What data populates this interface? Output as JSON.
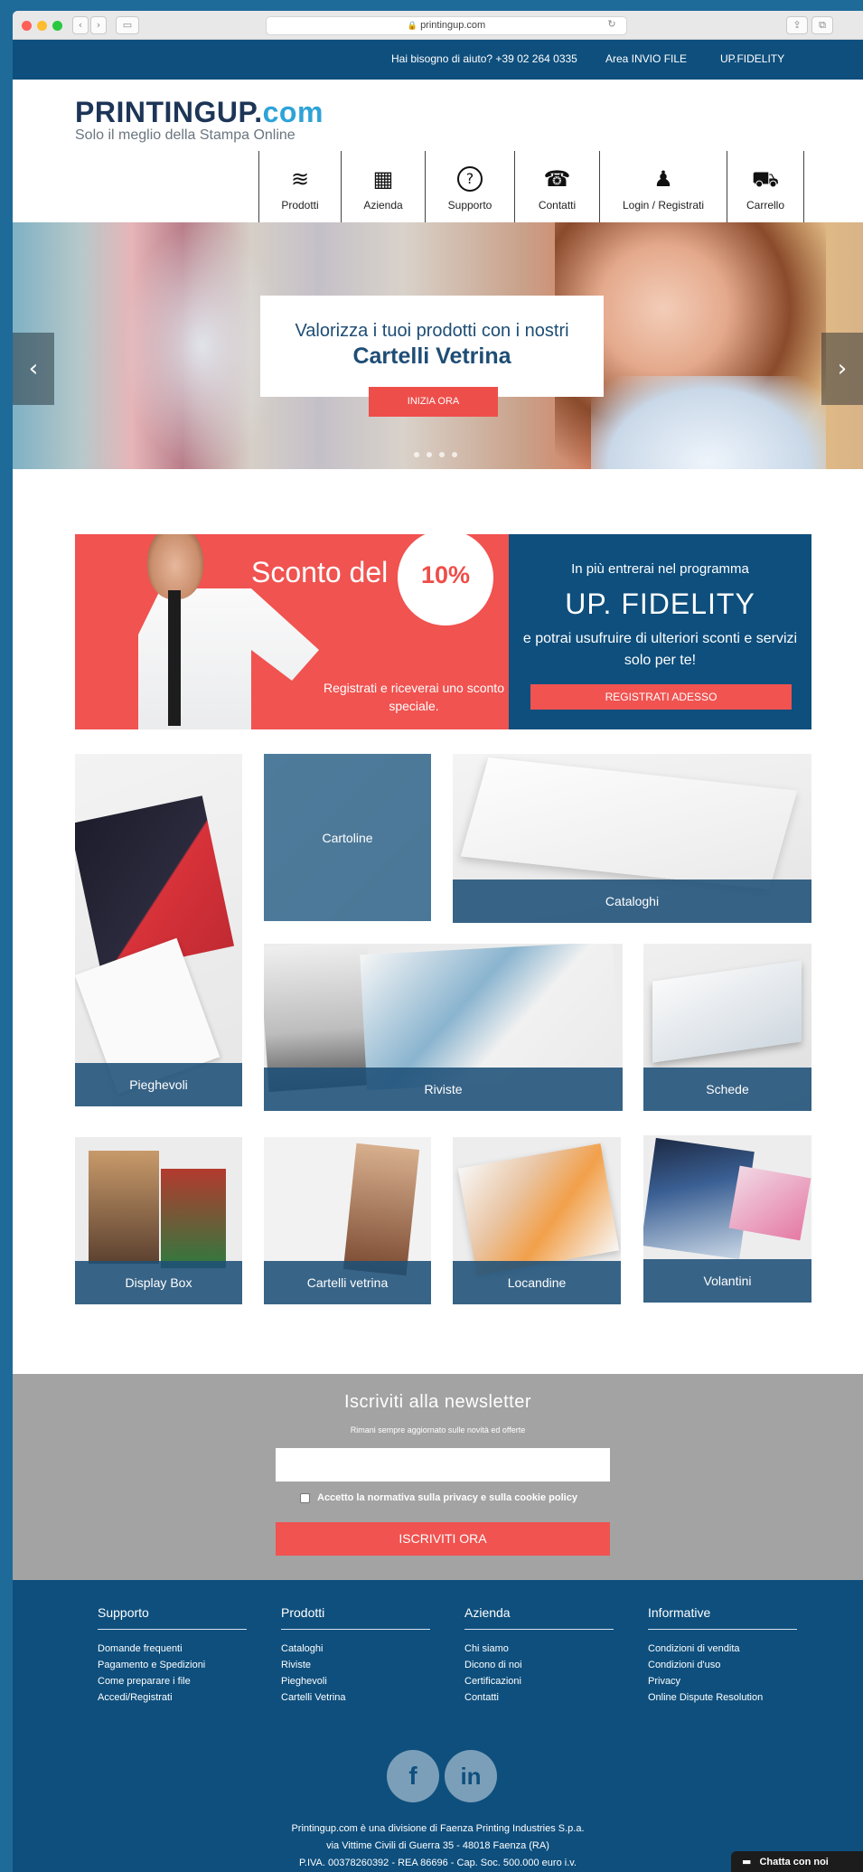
{
  "browser": {
    "url": "printingup.com",
    "lock_icon": "lock-icon",
    "colors": {
      "close": "#fe5f57",
      "minimize": "#febc2e",
      "zoom": "#28c840"
    }
  },
  "topbar": {
    "help_text": "Hai bisogno di aiuto? +39 02 264 0335",
    "upload_link": "Area INVIO FILE",
    "fidelity_link": "UP.FIDELITY"
  },
  "brand": {
    "logo_text": "PRINTINGUP.",
    "logo_suffix": "com",
    "tagline": "Solo il meglio della Stampa Online"
  },
  "nav": {
    "items": [
      {
        "label": "Prodotti",
        "icon": "layers-icon",
        "glyph": "≋"
      },
      {
        "label": "Azienda",
        "icon": "building-icon",
        "glyph": "▦"
      },
      {
        "label": "Supporto",
        "icon": "question-icon",
        "glyph": "?"
      },
      {
        "label": "Contatti",
        "icon": "phone-icon",
        "glyph": "☎"
      },
      {
        "label": "Login / Registrati",
        "icon": "user-icon",
        "glyph": "♟"
      },
      {
        "label": "Carrello",
        "icon": "cart-icon",
        "glyph": "⛟"
      }
    ]
  },
  "hero": {
    "line1": "Valorizza i tuoi prodotti con i nostri",
    "line2": "Cartelli Vetrina",
    "cta": "INIZIA ORA",
    "prev_glyph": "‹",
    "next_glyph": "›",
    "slides_count": 4
  },
  "promo": {
    "headline": "Sconto del",
    "badge": "10%",
    "sub": "Registrati e riceverai uno sconto speciale.",
    "right_line1": "In più entrerai nel programma",
    "right_title": "UP. FIDELITY",
    "right_text": "e potrai usufruire di ulteriori sconti e servizi solo per te!",
    "register_button": "REGISTRATI ADESSO",
    "colors": {
      "red": "#f05350",
      "navy": "#0e4f7d"
    }
  },
  "products": [
    {
      "label": "Pieghevoli"
    },
    {
      "label": "Cartoline"
    },
    {
      "label": "Cataloghi"
    },
    {
      "label": "Riviste"
    },
    {
      "label": "Schede"
    },
    {
      "label": "Display Box"
    },
    {
      "label": "Cartelli vetrina"
    },
    {
      "label": "Locandine"
    },
    {
      "label": "Volantini"
    }
  ],
  "newsletter": {
    "title": "Iscriviti alla newsletter",
    "subtitle": "Rimani sempre aggiornato sulle novità ed offerte",
    "email_value": "",
    "privacy_label": "Accetto la normativa sulla privacy e sulla cookie policy",
    "submit": "ISCRIVITI ORA"
  },
  "footer": {
    "columns": [
      {
        "title": "Supporto",
        "links": [
          "Domande frequenti",
          "Pagamento e Spedizioni",
          "Come preparare i file",
          "Accedi/Registrati"
        ]
      },
      {
        "title": "Prodotti",
        "links": [
          "Cataloghi",
          "Riviste",
          "Pieghevoli",
          "Cartelli Vetrina"
        ]
      },
      {
        "title": "Azienda",
        "links": [
          "Chi siamo",
          "Dicono di noi",
          "Certificazioni",
          "Contatti"
        ]
      },
      {
        "title": "Informative",
        "links": [
          "Condizioni di vendita",
          "Condizioni d'uso",
          "Privacy",
          "Online Dispute Resolution"
        ]
      }
    ],
    "social": [
      {
        "label": "f",
        "icon": "facebook-icon"
      },
      {
        "label": "in",
        "icon": "linkedin-icon"
      }
    ],
    "company_line1": "Printingup.com è una divisione di Faenza Printing Industries S.p.a.",
    "company_line2": "via Vittime Civili di Guerra 35 - 48018 Faenza (RA)",
    "company_line3": "P.IVA. 00378260392 - REA 86696 - Cap. Soc. 500.000 euro i.v.",
    "chat_label": "Chatta con noi",
    "chat_icon": "chat-bubble-icon"
  }
}
